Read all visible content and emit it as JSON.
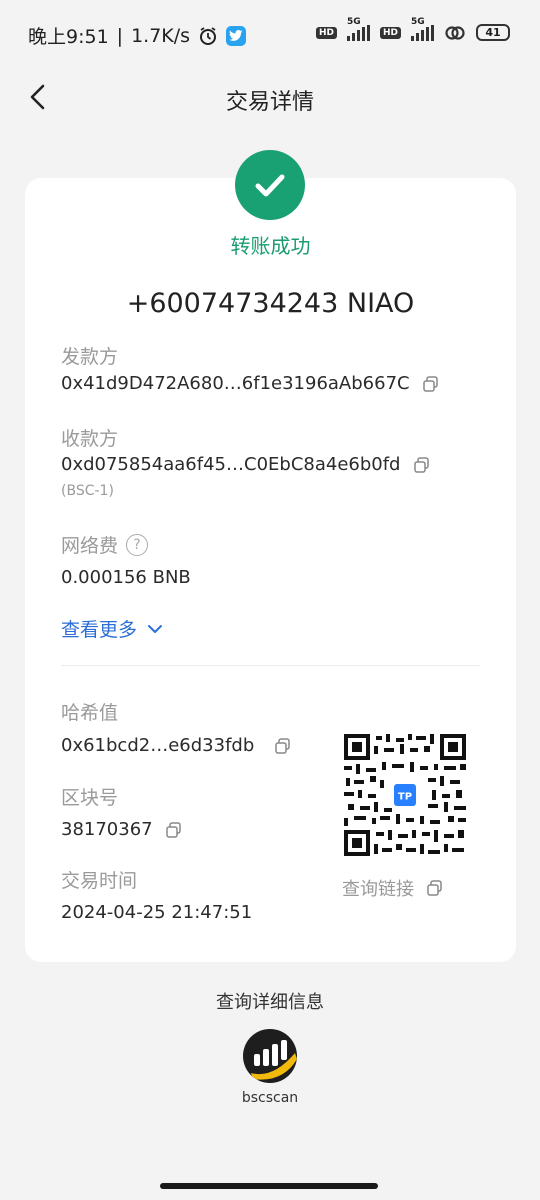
{
  "status_bar": {
    "time": "晚上9:51",
    "separator": "|",
    "net_speed": "1.7K/s",
    "hd1": "HD",
    "net1": "5G",
    "hd2": "HD",
    "net2": "5G",
    "battery": "41"
  },
  "header": {
    "title": "交易详情"
  },
  "status": {
    "text": "转账成功",
    "color": "#1aa173"
  },
  "amount": "+60074734243 NIAO",
  "sender": {
    "label": "发款方",
    "address": "0x41d9D472A680…6f1e3196aAb667C"
  },
  "receiver": {
    "label": "收款方",
    "address": "0xd075854aa6f45…C0EbC8a4e6b0fd",
    "network": "(BSC-1)"
  },
  "fee": {
    "label": "网络费",
    "help_symbol": "?",
    "value": "0.000156 BNB"
  },
  "see_more": "查看更多",
  "hash": {
    "label": "哈希值",
    "value": "0x61bcd2…e6d33fdb"
  },
  "block": {
    "label": "区块号",
    "value": "38170367"
  },
  "tx_time": {
    "label": "交易时间",
    "value": "2024-04-25 21:47:51"
  },
  "qr": {
    "badge": "TP",
    "link_label": "查询链接"
  },
  "footer": {
    "title": "查询详细信息",
    "explorer_name": "bscscan"
  },
  "colors": {
    "accent_link": "#2b6fd6",
    "success_green": "#1aa173",
    "page_bg": "#f3f3f4"
  }
}
